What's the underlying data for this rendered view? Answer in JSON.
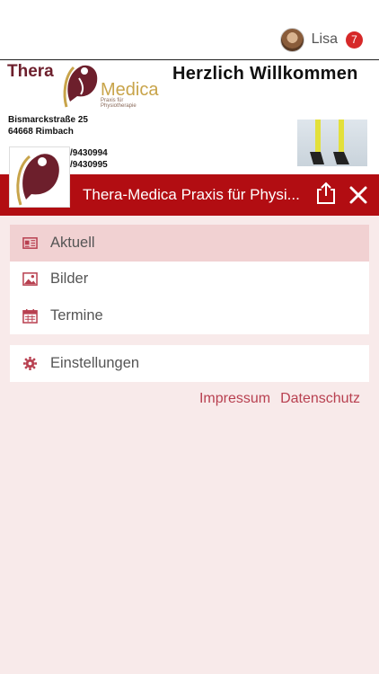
{
  "user": {
    "name": "Lisa",
    "notifications": "7"
  },
  "banner": {
    "logo_thera": "Thera",
    "logo_medica": "Medica",
    "logo_sub": "Praxis für Physiotherapie",
    "welcome": "Herzlich Willkommen",
    "street": "Bismarckstraße 25",
    "city": "64668 Rimbach",
    "phone1": "/9430994",
    "phone2": "/9430995"
  },
  "header": {
    "title": "Thera-Medica Praxis für Physi..."
  },
  "menu": {
    "main": [
      {
        "label": "Aktuell",
        "icon": "news-icon",
        "active": true
      },
      {
        "label": "Bilder",
        "icon": "image-icon",
        "active": false
      },
      {
        "label": "Termine",
        "icon": "calendar-icon",
        "active": false
      }
    ],
    "settings": {
      "label": "Einstellungen",
      "icon": "gear-icon"
    }
  },
  "footer_links": {
    "impressum": "Impressum",
    "datenschutz": "Datenschutz"
  },
  "colors": {
    "brand_red": "#b20d12",
    "active_bg": "#f1d1d2",
    "page_bg": "#f8eaea",
    "link": "#b84050",
    "icon": "#b84050"
  }
}
